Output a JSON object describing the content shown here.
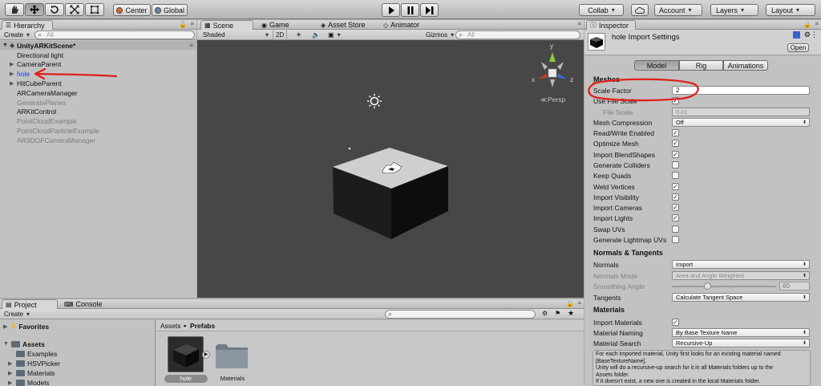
{
  "toolbar": {
    "pivot_label": "Center",
    "space_label": "Global",
    "collab_label": "Collab",
    "account_label": "Account",
    "layers_label": "Layers",
    "layout_label": "Layout"
  },
  "hierarchy": {
    "tab_label": "Hierarchy",
    "create_label": "Create",
    "search_placeholder": "All",
    "scene_name": "UnityARKitScene*",
    "items": [
      {
        "label": "Directional light",
        "muted": false,
        "expandable": false
      },
      {
        "label": "CameraParent",
        "muted": false,
        "expandable": true
      },
      {
        "label": "hole",
        "muted": false,
        "expandable": true,
        "selected_text": true
      },
      {
        "label": "HitCubeParent",
        "muted": false,
        "expandable": true
      },
      {
        "label": "ARCameraManager",
        "muted": false,
        "expandable": false
      },
      {
        "label": "GeneratePlanes",
        "muted": true,
        "expandable": false
      },
      {
        "label": "ARKitControl",
        "muted": false,
        "expandable": false
      },
      {
        "label": "PointCloudExample",
        "muted": true,
        "expandable": false
      },
      {
        "label": "PointCloudParticleExample",
        "muted": true,
        "expandable": false
      },
      {
        "label": "AR3DOFCameraManager",
        "muted": true,
        "expandable": false
      }
    ]
  },
  "scene": {
    "tabs": [
      "Scene",
      "Game",
      "Asset Store",
      "Animator"
    ],
    "shading_label": "Shaded",
    "mode_2d_label": "2D",
    "gizmos_label": "Gizmos",
    "search_placeholder": "All",
    "persp_label": "Persp",
    "axis_x": "x",
    "axis_y": "y",
    "axis_z": "z"
  },
  "project": {
    "tabs": [
      "Project",
      "Console"
    ],
    "create_label": "Create",
    "favorites_label": "Favorites",
    "assets_label": "Assets",
    "folders": [
      "Examples",
      "HSVPicker",
      "Materials",
      "Models"
    ],
    "breadcrumb": [
      "Assets",
      "Prefabs"
    ],
    "breadcrumb_sep": "▸",
    "files": [
      "hole",
      "Materials"
    ]
  },
  "inspector": {
    "tab_label": "Inspector",
    "title": "hole Import Settings",
    "open_label": "Open",
    "tabs": [
      "Model",
      "Rig",
      "Animations"
    ],
    "meshes_header": "Meshes",
    "scale_factor_label": "Scale Factor",
    "scale_factor_value": "2",
    "use_file_scale_label": "Use File Scale",
    "file_scale_label": "File Scale",
    "file_scale_value": "0.01",
    "mesh_compression_label": "Mesh Compression",
    "mesh_compression_value": "Off",
    "checkbox_rows": [
      {
        "label": "Read/Write Enabled",
        "checked": true
      },
      {
        "label": "Optimize Mesh",
        "checked": true
      },
      {
        "label": "Import BlendShapes",
        "checked": true
      },
      {
        "label": "Generate Colliders",
        "checked": false
      },
      {
        "label": "Keep Quads",
        "checked": false
      },
      {
        "label": "Weld Vertices",
        "checked": true
      },
      {
        "label": "Import Visibility",
        "checked": true
      },
      {
        "label": "Import Cameras",
        "checked": true
      },
      {
        "label": "Import Lights",
        "checked": true
      },
      {
        "label": "Swap UVs",
        "checked": false
      },
      {
        "label": "Generate Lightmap UVs",
        "checked": false
      }
    ],
    "normals_header": "Normals & Tangents",
    "normals_label": "Normals",
    "normals_value": "Import",
    "normals_mode_label": "Normals Mode",
    "normals_mode_value": "Area and Angle Weighted",
    "smoothing_label": "Smoothing Angle",
    "smoothing_value": "60",
    "tangents_label": "Tangents",
    "tangents_value": "Calculate Tangent Space",
    "materials_header": "Materials",
    "import_materials_label": "Import Materials",
    "material_naming_label": "Material Naming",
    "material_naming_value": "By Base Texture Name",
    "material_search_label": "Material Search",
    "material_search_value": "Recursive-Up",
    "help_lines": [
      "For each imported material, Unity first looks for an existing material named",
      "[BaseTextureName].",
      "Unity will do a recursive-up search for it in all Materials folders up to the",
      "Assets folder.",
      "If it doesn't exist, a new one is created in the local Materials folder."
    ]
  },
  "annotation_color": "#e0201a",
  "link_color": "#1a3fd8"
}
